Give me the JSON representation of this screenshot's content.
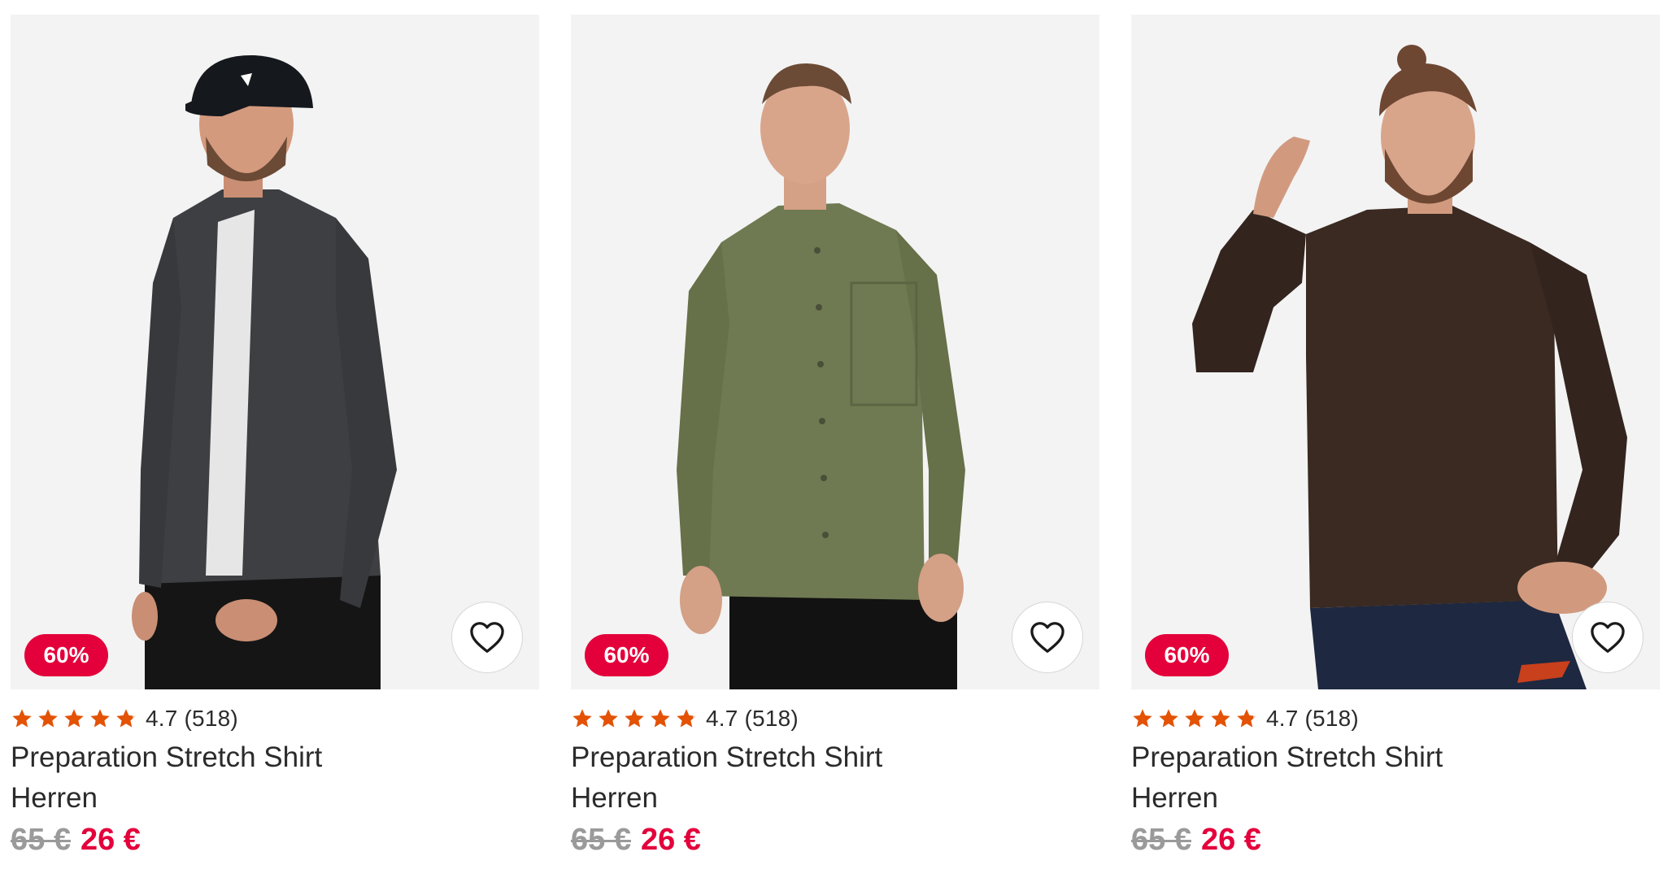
{
  "products": [
    {
      "discount": "60%",
      "rating": "4.7",
      "review_count": "(518)",
      "stars_filled": 4.7,
      "title": "Preparation Stretch Shirt",
      "subtitle": "Herren",
      "old_price": "65 €",
      "new_price": "26 €",
      "shirt_color": "#3d3f42",
      "pants_color": "#151515"
    },
    {
      "discount": "60%",
      "rating": "4.7",
      "review_count": "(518)",
      "stars_filled": 4.7,
      "title": "Preparation Stretch Shirt",
      "subtitle": "Herren",
      "old_price": "65 €",
      "new_price": "26 €",
      "shirt_color": "#6f7a52",
      "pants_color": "#121212"
    },
    {
      "discount": "60%",
      "rating": "4.7",
      "review_count": "(518)",
      "stars_filled": 4.7,
      "title": "Preparation Stretch Shirt",
      "subtitle": "Herren",
      "old_price": "65 €",
      "new_price": "26 €",
      "shirt_color": "#3a2a22",
      "pants_color": "#1e2840"
    }
  ],
  "colors": {
    "sale_red": "#e4003b",
    "star_orange": "#e35205",
    "image_bg": "#f3f3f3"
  },
  "icons": {
    "wishlist": "heart-outline-icon",
    "rating": "star-icon"
  }
}
